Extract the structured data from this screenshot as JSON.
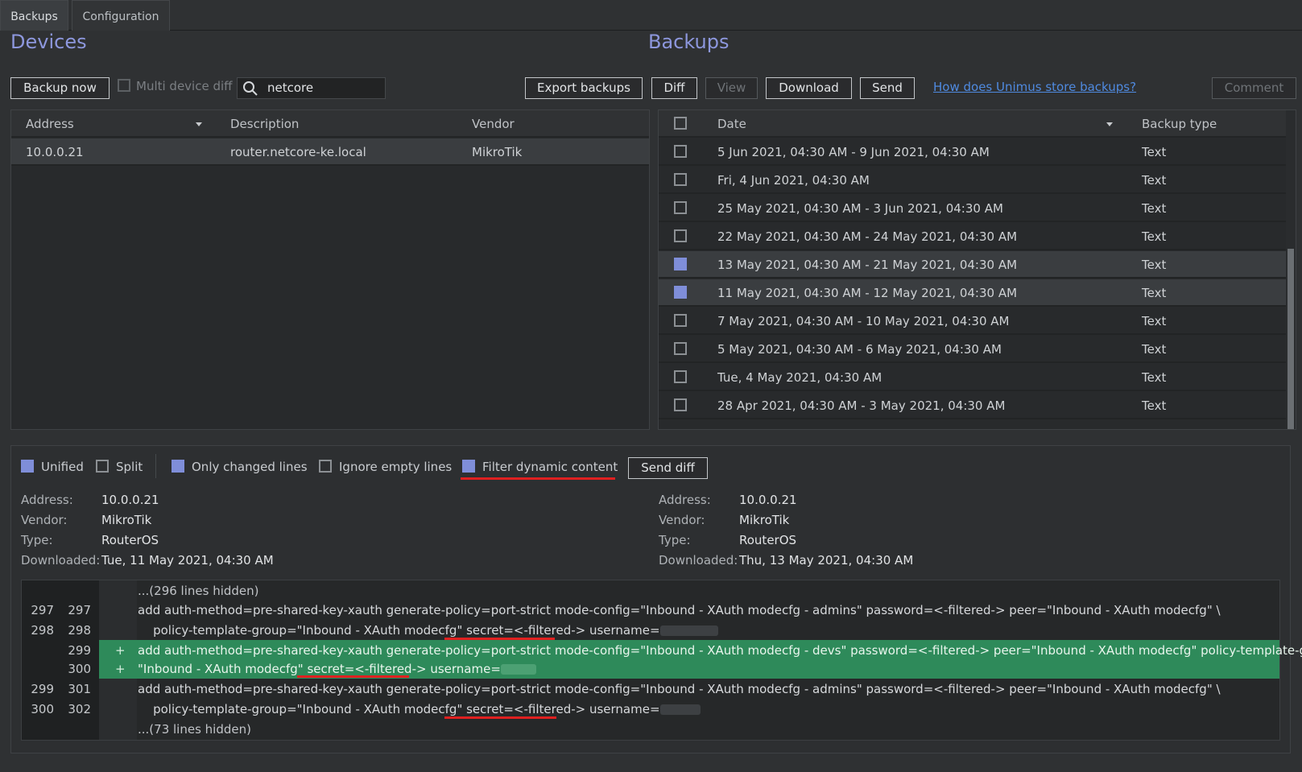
{
  "tabs": [
    {
      "label": "Backups",
      "active": true
    },
    {
      "label": "Configuration",
      "active": false
    }
  ],
  "devices": {
    "title": "Devices",
    "backup_now": "Backup now",
    "multi_device_diff": "Multi device diff",
    "search_value": "netcore",
    "columns": [
      "Address",
      "Description",
      "Vendor"
    ],
    "rows": [
      {
        "address": "10.0.0.21",
        "description": "router.netcore-ke.local",
        "vendor": "MikroTik",
        "selected": true
      }
    ]
  },
  "backups": {
    "title": "Backups",
    "buttons": {
      "export": "Export backups",
      "diff": "Diff",
      "view": "View",
      "download": "Download",
      "send": "Send",
      "comment": "Comment"
    },
    "help_link": "How does Unimus store backups?",
    "columns": [
      "Date",
      "Backup type"
    ],
    "rows": [
      {
        "date": "5 Jun 2021, 04:30 AM - 9 Jun 2021, 04:30 AM",
        "type": "Text",
        "checked": false
      },
      {
        "date": "Fri, 4 Jun 2021, 04:30 AM",
        "type": "Text",
        "checked": false
      },
      {
        "date": "25 May 2021, 04:30 AM - 3 Jun 2021, 04:30 AM",
        "type": "Text",
        "checked": false
      },
      {
        "date": "22 May 2021, 04:30 AM - 24 May 2021, 04:30 AM",
        "type": "Text",
        "checked": false
      },
      {
        "date": "13 May 2021, 04:30 AM - 21 May 2021, 04:30 AM",
        "type": "Text",
        "checked": true
      },
      {
        "date": "11 May 2021, 04:30 AM - 12 May 2021, 04:30 AM",
        "type": "Text",
        "checked": true
      },
      {
        "date": "7 May 2021, 04:30 AM - 10 May 2021, 04:30 AM",
        "type": "Text",
        "checked": false
      },
      {
        "date": "5 May 2021, 04:30 AM - 6 May 2021, 04:30 AM",
        "type": "Text",
        "checked": false
      },
      {
        "date": "Tue, 4 May 2021, 04:30 AM",
        "type": "Text",
        "checked": false
      },
      {
        "date": "28 Apr 2021, 04:30 AM - 3 May 2021, 04:30 AM",
        "type": "Text",
        "checked": false
      }
    ]
  },
  "diff_options": {
    "unified": {
      "label": "Unified",
      "checked": true
    },
    "split": {
      "label": "Split",
      "checked": false
    },
    "only_changed": {
      "label": "Only changed lines",
      "checked": true
    },
    "ignore_empty": {
      "label": "Ignore empty lines",
      "checked": false
    },
    "filter_dynamic": {
      "label": "Filter dynamic content",
      "checked": true
    },
    "send_diff": "Send diff"
  },
  "left_meta": {
    "address_label": "Address:",
    "address": "10.0.0.21",
    "vendor_label": "Vendor:",
    "vendor": "MikroTik",
    "type_label": "Type:",
    "type": "RouterOS",
    "downloaded_label": "Downloaded:",
    "downloaded": "Tue, 11 May 2021, 04:30 AM"
  },
  "right_meta": {
    "address_label": "Address:",
    "address": "10.0.0.21",
    "vendor_label": "Vendor:",
    "vendor": "MikroTik",
    "type_label": "Type:",
    "type": "RouterOS",
    "downloaded_label": "Downloaded:",
    "downloaded": "Thu, 13 May 2021, 04:30 AM"
  },
  "diff_lines": {
    "hidden_top": "...(296 lines hidden)",
    "l1": {
      "n1": "297",
      "n2": "297",
      "text": "add auth-method=pre-shared-key-xauth generate-policy=port-strict mode-config=\"Inbound - XAuth modecfg - admins\" password=<-filtered-> peer=\"Inbound - XAuth modecfg\" \\"
    },
    "l2": {
      "n1": "298",
      "n2": "298",
      "text_a": "    policy-template-group=\"Inbound - XAuth modecfg\" ",
      "secret": "secret=<-filtered->",
      "text_b": " username="
    },
    "l3": {
      "n2": "299",
      "plus": "+",
      "text": "add auth-method=pre-shared-key-xauth generate-policy=port-strict mode-config=\"Inbound - XAuth modecfg - devs\" password=<-filtered-> peer=\"Inbound - XAuth modecfg\" policy-template-group=\\"
    },
    "l4": {
      "n2": "300",
      "plus": "+",
      "text_a": "\"Inbound - XAuth modecfg\" ",
      "secret": "secret=<-filtered->",
      "text_b": " username="
    },
    "l5": {
      "n1": "299",
      "n2": "301",
      "text": "add auth-method=pre-shared-key-xauth generate-policy=port-strict mode-config=\"Inbound - XAuth modecfg - admins\" password=<-filtered-> peer=\"Inbound - XAuth modecfg\" \\"
    },
    "l6": {
      "n1": "300",
      "n2": "302",
      "text_a": "    policy-template-group=\"Inbound - XAuth modecfg\" ",
      "secret": "secret=<-filtered->",
      "text_b": " username="
    },
    "hidden_bottom": "...(73 lines hidden)"
  },
  "colors": {
    "accent": "#7f8ed9",
    "added_line": "#2e8a5a",
    "highlight_underline": "#e02020",
    "link": "#4f8ae0"
  }
}
